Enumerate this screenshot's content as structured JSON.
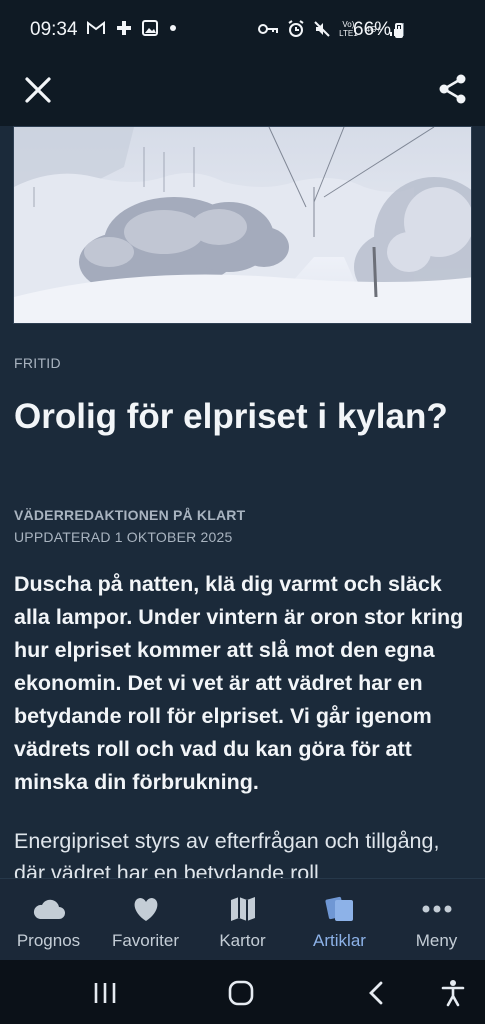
{
  "status_bar": {
    "time": "09:34",
    "left_icons": [
      "gmail-icon",
      "medical-icon",
      "image-icon",
      "dot-icon"
    ],
    "right_icons": [
      "key-icon",
      "alarm-icon",
      "mute-icon",
      "volte-icon",
      "4g-icon",
      "signal-icon"
    ],
    "network_label_top": "Vo)",
    "network_label_bottom": "LTE1",
    "network_4g": "4G+",
    "battery_percent": "66%"
  },
  "header": {
    "close_icon": "close-icon",
    "share_icon": "share-icon"
  },
  "article": {
    "category": "FRITID",
    "title": "Orolig för elpriset i kylan?",
    "author": "VÄDERREDAKTIONEN PÅ KLART",
    "updated": "UPPDATERAD 1 OKTOBER 2025",
    "lead": "Duscha på natten, klä dig varmt och släck alla lampor. Under vintern är oron stor kring hur elpriset kommer att slå mot den egna ekonomin. Det vi vet är att vädret har en betydande roll för elpriset. Vi går igenom vädrets roll och vad du kan göra för att minska din förbrukning.",
    "body": "Energipriset styrs av efterfrågan och tillgång, där vädret har en betydande roll"
  },
  "bottom_nav": {
    "items": [
      {
        "label": "Prognos",
        "icon": "cloud-icon"
      },
      {
        "label": "Favoriter",
        "icon": "heart-icon"
      },
      {
        "label": "Kartor",
        "icon": "map-icon"
      },
      {
        "label": "Artiklar",
        "icon": "articles-icon"
      },
      {
        "label": "Meny",
        "icon": "more-icon"
      }
    ],
    "active_index": 3
  },
  "system_nav": {
    "icons": [
      "recents-icon",
      "home-icon",
      "back-icon",
      "accessibility-icon"
    ]
  },
  "colors": {
    "background": "#1b2a3a",
    "header": "#0f1a24",
    "active_accent": "#8db2e8",
    "text_primary": "#f2f5f8",
    "text_muted": "#a9b4c0"
  }
}
